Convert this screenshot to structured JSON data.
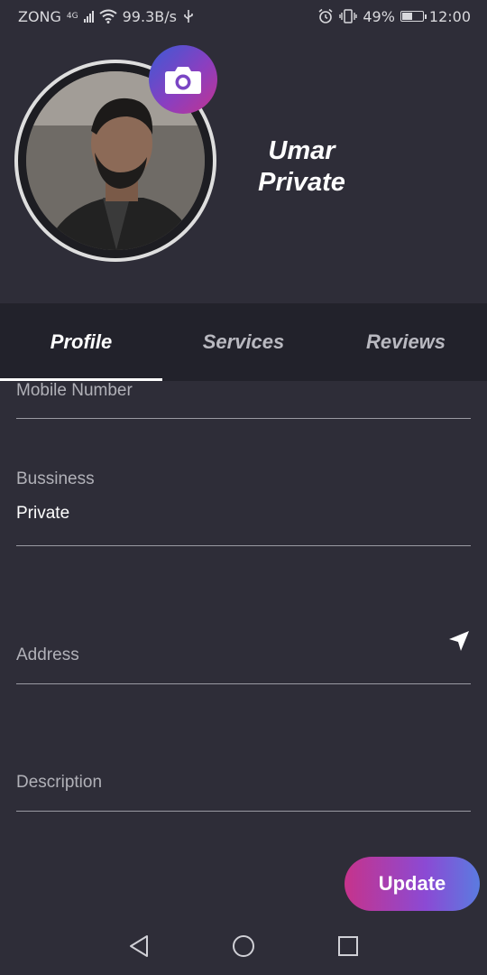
{
  "status": {
    "carrier": "ZONG",
    "network_type": "4G",
    "speed": "99.3B/s",
    "battery": "49%",
    "time": "12:00",
    "icons": [
      "signal-icon",
      "wifi-icon",
      "usb-icon",
      "alarm-icon",
      "vibrate-icon",
      "battery-icon"
    ]
  },
  "profile": {
    "name_line1": "Umar",
    "name_line2": "Private",
    "camera_icon": "camera-icon",
    "accent_gradient": [
      "#3a5bd6",
      "#8a3fc0",
      "#c2338f"
    ]
  },
  "tabs": [
    {
      "label": "Profile",
      "active": true
    },
    {
      "label": "Services",
      "active": false
    },
    {
      "label": "Reviews",
      "active": false
    }
  ],
  "form": {
    "mobile": {
      "label": "Mobile Number",
      "value": ""
    },
    "business": {
      "label": "Bussiness",
      "value": "Private"
    },
    "address": {
      "label": "Address",
      "value": "",
      "icon": "location-arrow-icon"
    },
    "description": {
      "label": "Description",
      "value": ""
    }
  },
  "actions": {
    "update_label": "Update"
  },
  "navbar": {
    "icons": [
      "back-icon",
      "home-icon",
      "recents-icon"
    ]
  }
}
